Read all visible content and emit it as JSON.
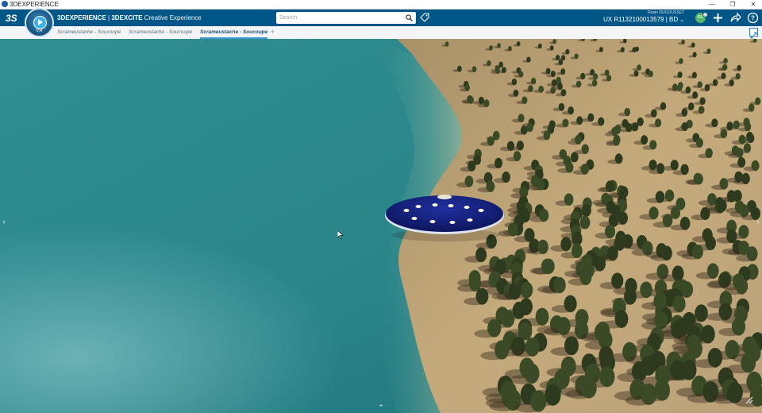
{
  "window": {
    "title": "3DEXPERIENCE",
    "controls": {
      "minimize": "—",
      "maximize": "❐",
      "close": "✕"
    }
  },
  "header": {
    "brand_primary": "3DEXPERIENCE",
    "brand_separator": " | ",
    "brand_app": "3DEXCITE",
    "brand_role": " Creative Experience",
    "compass_label": "V,R",
    "search_placeholder": "Search",
    "user_name": "Rosin DUGOUSSET",
    "collab_space": "UX R1132100013579 | BD",
    "avatar_initials": "RD",
    "icons": {
      "logo": "ds-logo-icon",
      "compass": "compass-icon",
      "search": "search-icon",
      "tag": "tag-icon",
      "add": "plus-icon",
      "share": "share-icon",
      "help": "help-icon"
    }
  },
  "tabs": [
    {
      "label": "Scrameustache - Soucoupe",
      "active": false
    },
    {
      "label": "Scrameustache - Soucoupe",
      "active": false
    },
    {
      "label": "Scrameustache - Soucoupe",
      "active": true
    }
  ],
  "tab_add_label": "+",
  "viewport": {
    "scene": "ufo-over-coastline",
    "left_arrow": "‹",
    "right_arrow": "›",
    "bottom_handle": "⌃"
  },
  "colors": {
    "header_bg": "#005686",
    "accent": "#3b9ad4",
    "water": "#2c8c90",
    "sand": "#c2a676",
    "ufo": "#101a6e"
  }
}
